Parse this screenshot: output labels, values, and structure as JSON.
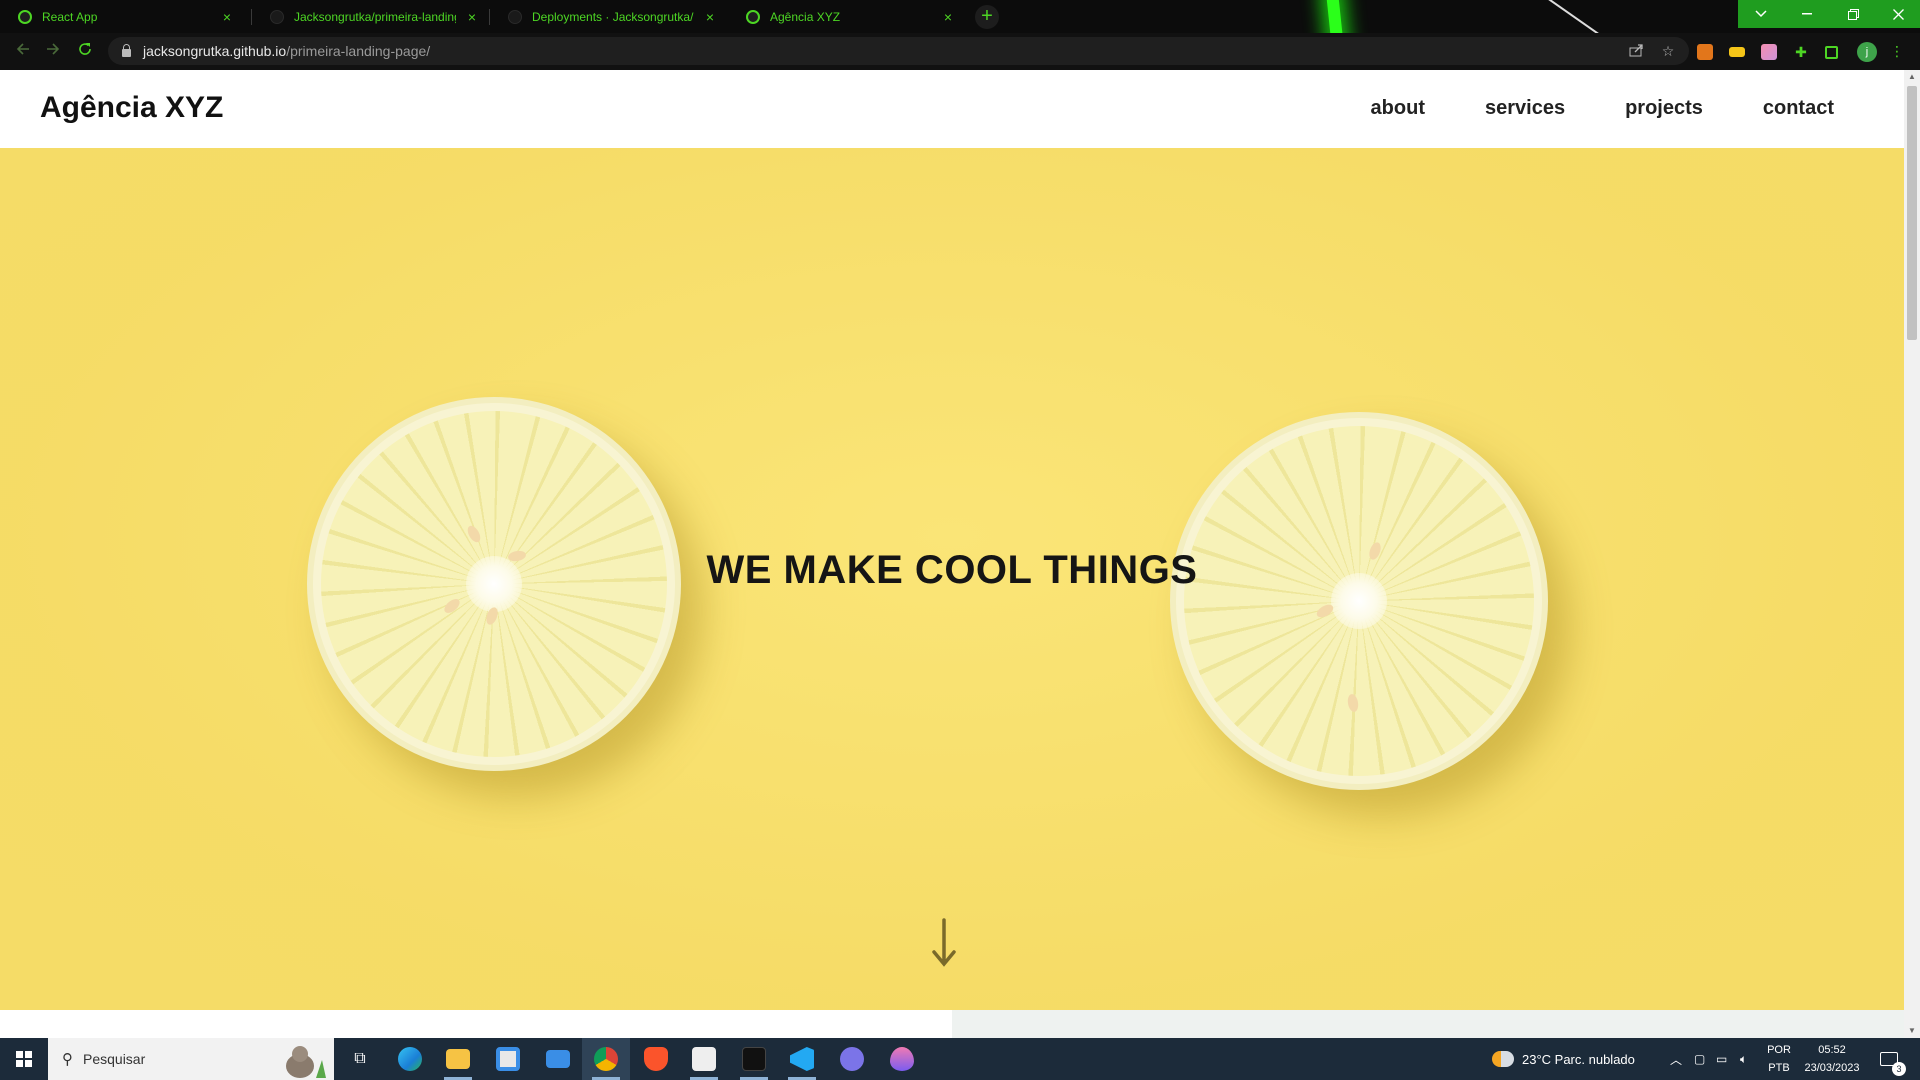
{
  "browser": {
    "tabs": [
      {
        "title": "React App",
        "favicon": "globe-icon",
        "active": false
      },
      {
        "title": "Jacksongrutka/primeira-landing-",
        "favicon": "github-icon",
        "active": false
      },
      {
        "title": "Deployments · Jacksongrutka/pri",
        "favicon": "github-icon",
        "active": false
      },
      {
        "title": "Agência XYZ",
        "favicon": "globe-icon",
        "active": true
      }
    ],
    "url_host": "jacksongrutka.github.io",
    "url_path": "/primeira-landing-page/",
    "profile_initial": "j",
    "accent": "#4dd624"
  },
  "site": {
    "logo": "Agência XYZ",
    "menu": [
      "about",
      "services",
      "projects",
      "contact"
    ],
    "hero_title": "WE MAKE COOL THINGS",
    "hero_bg": "#f8df6c"
  },
  "taskbar": {
    "search_placeholder": "Pesquisar",
    "weather": "23°C  Parc. nublado",
    "lang_top": "POR",
    "lang_bottom": "PTB",
    "time": "05:52",
    "date": "23/03/2023",
    "notifications": "3",
    "apps": [
      "task-view-icon",
      "edge-icon",
      "file-explorer-icon",
      "store-icon",
      "mail-icon",
      "chrome-icon",
      "brave-icon",
      "app-icon",
      "terminal-icon",
      "vscode-icon",
      "discord-icon",
      "drop-icon"
    ]
  }
}
